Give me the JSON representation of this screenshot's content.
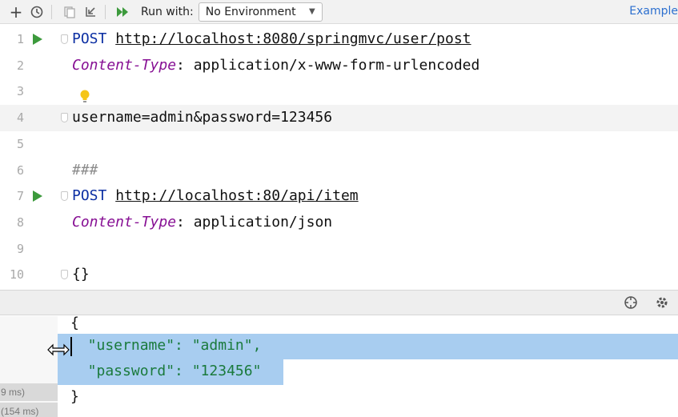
{
  "toolbar": {
    "add_icon": "+",
    "history_icon": "clock-icon",
    "run_with_label": "Run with:",
    "environment_selected": "No Environment",
    "examples_link": "Example"
  },
  "editor": {
    "lines": [
      {
        "n": "1",
        "method": "POST",
        "url": "http://localhost:8080/springmvc/user/post",
        "runnable": true
      },
      {
        "n": "2",
        "header_name": "Content-Type",
        "header_rest": ": application/x-www-form-urlencoded"
      },
      {
        "n": "3",
        "text": ""
      },
      {
        "n": "4",
        "text": "username=admin&password=123456"
      },
      {
        "n": "5",
        "text": ""
      },
      {
        "n": "6",
        "comment": "###"
      },
      {
        "n": "7",
        "method": "POST",
        "url": "http://localhost:80/api/item",
        "runnable": true
      },
      {
        "n": "8",
        "header_name": "Content-Type",
        "header_rest": ": application/json"
      },
      {
        "n": "9",
        "text": ""
      },
      {
        "n": "10",
        "text": "{}"
      }
    ]
  },
  "response": {
    "lines": [
      "{",
      "  \"username\": \"admin\",",
      "  \"password\": \"123456\"",
      "}"
    ],
    "side_labels": [
      "9 ms)",
      "(154 ms)"
    ]
  },
  "colors": {
    "method": "#0c2fa3",
    "header_name": "#871094",
    "selection": "#a8cdf0",
    "run_arrow": "#3c9a3c"
  }
}
